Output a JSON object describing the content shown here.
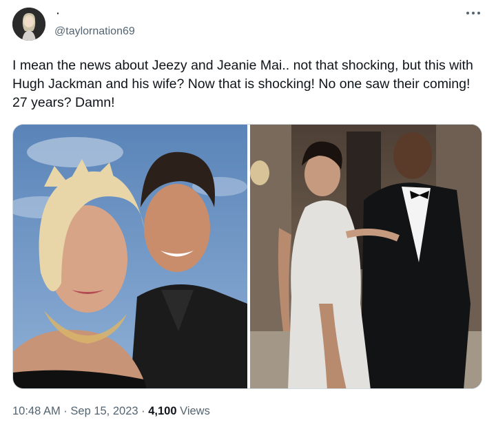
{
  "author": {
    "display_name": "·",
    "handle": "@taylornation69",
    "avatar_icon": "profile-avatar"
  },
  "more_icon": "more-horizontal-icon",
  "tweet": {
    "text": "I mean the news about Jeezy and Jeanie Mai.. not that shocking, but this with Hugh Jackman and his wife? Now that is shocking! No one saw their coming! 27 years? Damn!"
  },
  "media": {
    "count": 2
  },
  "meta": {
    "time": "10:48 AM",
    "separator": " · ",
    "date": "Sep 15, 2023",
    "views_count": "4,100",
    "views_label": " Views"
  },
  "colors": {
    "text": "#0f1419",
    "secondary": "#536471",
    "border": "#cfd9de"
  }
}
